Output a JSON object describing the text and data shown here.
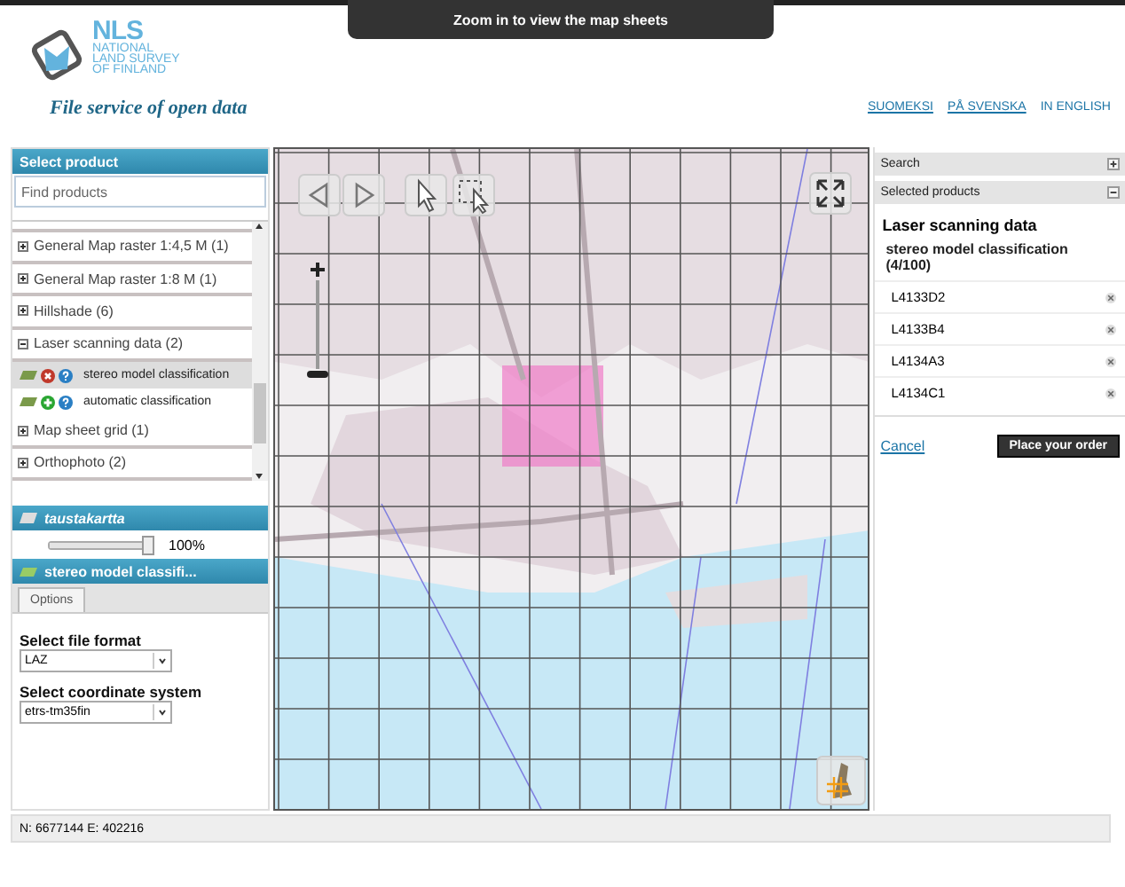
{
  "tooltip": "Zoom in to view the map sheets",
  "header": {
    "logo": {
      "abbr": "NLS",
      "lines": [
        "NATIONAL",
        "LAND SURVEY",
        "OF FINLAND"
      ]
    },
    "subtitle": "File service of open data",
    "languages": [
      {
        "label": "SUOMEKSI",
        "selected": false
      },
      {
        "label": "PÅ SVENSKA",
        "selected": false
      },
      {
        "label": "IN ENGLISH",
        "selected": true
      }
    ]
  },
  "product_panel": {
    "title": "Select product",
    "search": {
      "placeholder": "Find products"
    },
    "products": [
      {
        "label": "General Map raster 1:4,5 M (1)",
        "expanded": false
      },
      {
        "label": "General Map raster 1:8 M (1)",
        "expanded": false
      },
      {
        "label": "Hillshade (6)",
        "expanded": false
      },
      {
        "label": "Laser scanning data (2)",
        "expanded": true,
        "children": [
          {
            "label": "stereo model classification",
            "selected": true
          },
          {
            "label": "automatic classification",
            "selected": false
          }
        ]
      },
      {
        "label": "Map sheet grid (1)",
        "expanded": false
      },
      {
        "label": "Orthophoto (2)",
        "expanded": false
      }
    ]
  },
  "layer_panel": {
    "title": "taustakartta",
    "opacity": {
      "level": 1,
      "reading": "100%"
    }
  },
  "options_panel": {
    "title": "stereo model classifi...",
    "tabs": [
      {
        "label": "Options",
        "selected": true
      }
    ],
    "fields": [
      {
        "label": "Select file format",
        "value": "LAZ"
      },
      {
        "label": "Select coordinate system",
        "value": "etrs-tm35fin"
      }
    ]
  },
  "right_panel": {
    "sections": [
      {
        "title": "Search",
        "expanded": false
      },
      {
        "title": "Selected products",
        "expanded": true
      }
    ],
    "dataset": "Laser scanning data",
    "product": "stereo model classification (4/100)",
    "sheets": [
      "L4133D2",
      "L4133B4",
      "L4134A3",
      "L4134C1"
    ],
    "cancel": "Cancel",
    "order_button": "Place your order"
  },
  "status_bar": "N: 6677144 E: 402216"
}
